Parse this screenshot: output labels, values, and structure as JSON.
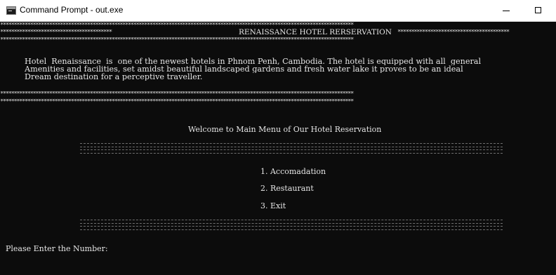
{
  "window": {
    "title": "Command Prompt - out.exe",
    "minimize_glyph": "—",
    "maximize_glyph": "☐"
  },
  "console": {
    "star_row": "**********************************************************************************************************************************",
    "header_left": "*****************************************",
    "header_title": "RENAISSANCE HOTEL RERSERVATION",
    "header_right": "*****************************************",
    "description_lines": [
      "Hotel  Renaissance  is  one of the newest hotels in Phnom Penh, Cambodia. The hotel is equipped with all  general",
      "Amenities and facilities, set amidst beautiful landscaped gardens and fresh water lake it proves to be an ideal",
      "Dream destination for a perceptive traveller."
    ],
    "welcome": "Welcome to Main Menu of Our Hotel Reservation",
    "menu": [
      "1. Accomadation",
      "2. Restaurant",
      "3. Exit"
    ],
    "prompt": "Please Enter the Number:"
  }
}
